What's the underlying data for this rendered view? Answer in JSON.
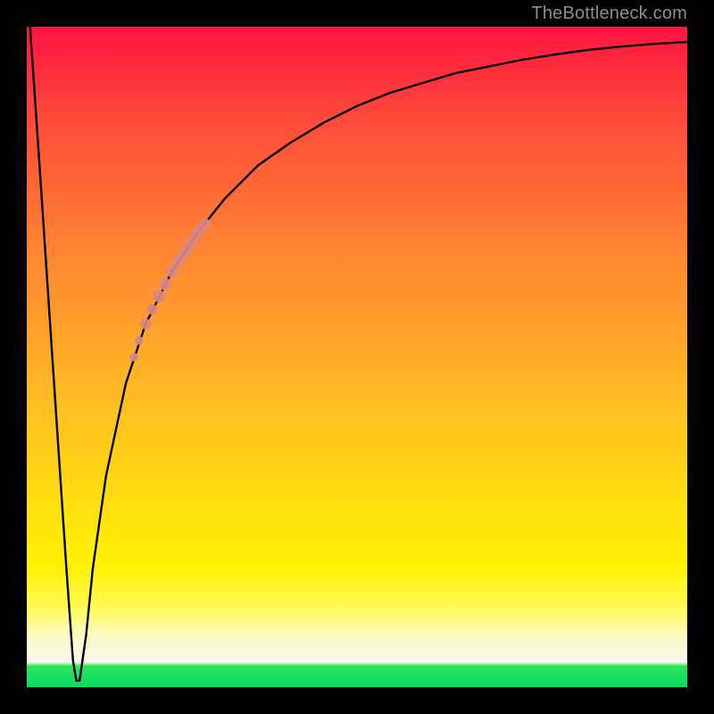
{
  "watermark": {
    "text": "TheBottleneck.com"
  },
  "colors": {
    "frame": "#000000",
    "curve": "#000000",
    "marker": "#d98787",
    "gradient_top": "#ff1440",
    "gradient_mid": "#ffe70a",
    "gradient_bottom_band": "#19e061"
  },
  "chart_data": {
    "type": "line",
    "title": "",
    "xlabel": "",
    "ylabel": "",
    "xlim": [
      0,
      100
    ],
    "ylim": [
      0,
      100
    ],
    "grid": false,
    "legend": false,
    "series": [
      {
        "name": "bottleneck-curve",
        "x": [
          0.5,
          2,
          4,
          6,
          7,
          7.5,
          8,
          9,
          10,
          12,
          15,
          18,
          22,
          26,
          30,
          35,
          40,
          45,
          50,
          55,
          60,
          65,
          70,
          75,
          80,
          85,
          90,
          95,
          100
        ],
        "y": [
          100,
          78,
          48,
          18,
          4,
          1,
          1,
          8,
          18,
          32,
          46,
          55,
          63,
          69,
          74,
          79,
          82.5,
          85.5,
          88,
          90,
          91.5,
          93,
          94,
          95,
          95.8,
          96.5,
          97,
          97.4,
          97.7
        ]
      }
    ],
    "markers": [
      {
        "series": "bottleneck-curve",
        "x": 18,
        "y": 55,
        "r": 6
      },
      {
        "series": "bottleneck-curve",
        "x": 19,
        "y": 57.2,
        "r": 6
      },
      {
        "series": "bottleneck-curve",
        "x": 20,
        "y": 59.2,
        "r": 7
      },
      {
        "series": "bottleneck-curve",
        "x": 21,
        "y": 61,
        "r": 7
      },
      {
        "series": "bottleneck-curve",
        "x": 22,
        "y": 63,
        "r": 7
      },
      {
        "series": "bottleneck-curve",
        "x": 23,
        "y": 64.6,
        "r": 7
      },
      {
        "series": "bottleneck-curve",
        "x": 24,
        "y": 66,
        "r": 7
      },
      {
        "series": "bottleneck-curve",
        "x": 25,
        "y": 67.5,
        "r": 7
      },
      {
        "series": "bottleneck-curve",
        "x": 26,
        "y": 69,
        "r": 7
      },
      {
        "series": "bottleneck-curve",
        "x": 27,
        "y": 70.2,
        "r": 6
      },
      {
        "series": "bottleneck-curve",
        "x": 17,
        "y": 52.5,
        "r": 5
      },
      {
        "series": "bottleneck-curve",
        "x": 16.2,
        "y": 50,
        "r": 5
      }
    ],
    "annotations": []
  }
}
